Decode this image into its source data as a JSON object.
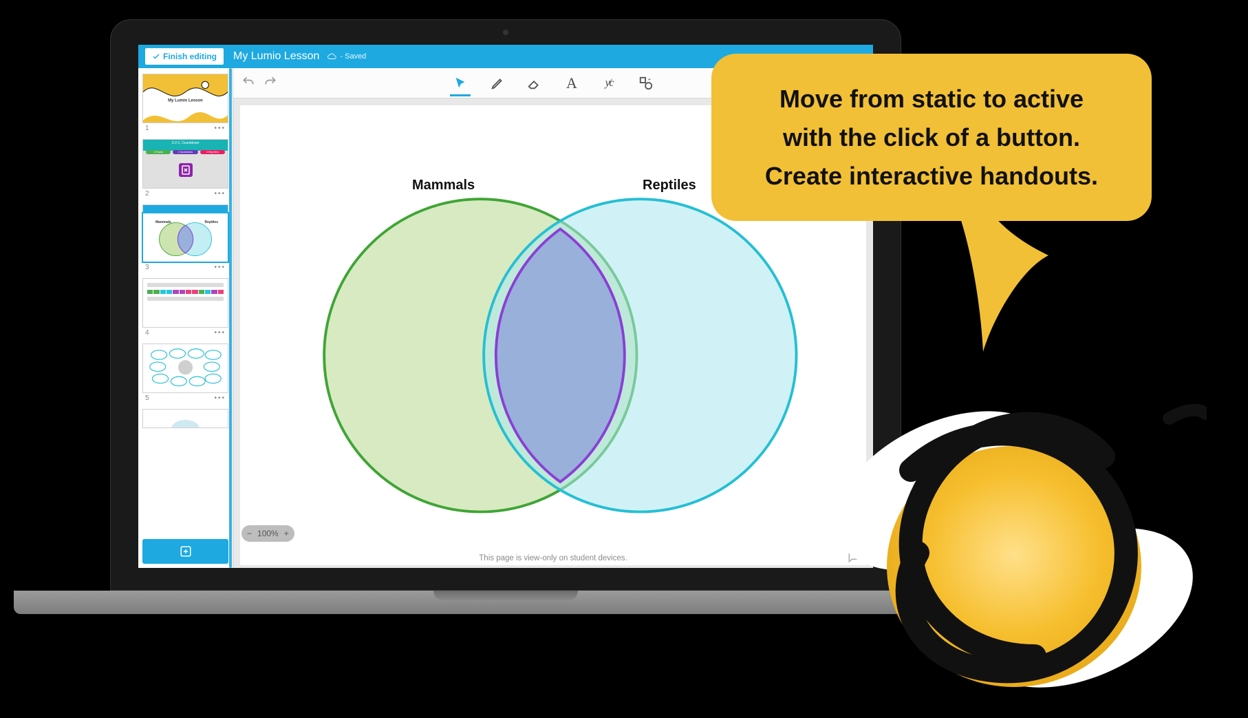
{
  "topbar": {
    "finish_label": "Finish editing",
    "title": "My Lumio Lesson",
    "saved_label": "- Saved"
  },
  "thumbs": [
    {
      "n": "1",
      "title": "My Lumio Lesson"
    },
    {
      "n": "2",
      "title": "3-2-1, Countdown",
      "pills": [
        "3 Facts",
        "2 Questions",
        "1 Big Idea"
      ]
    },
    {
      "n": "3",
      "left": "Mammals",
      "right": "Reptiles"
    },
    {
      "n": "4"
    },
    {
      "n": "5"
    }
  ],
  "canvas": {
    "left_label": "Mammals",
    "right_label": "Reptiles"
  },
  "zoom": {
    "value": "100%"
  },
  "footer": {
    "note": "This page is view-only on student devices."
  },
  "bubble": {
    "line1": "Move from static to active",
    "line2": "with the click of a button.",
    "line3": "Create interactive handouts."
  },
  "colors": {
    "brand": "#1ea9e1",
    "bubble": "#f2c036",
    "venn_left_stroke": "#3fa535",
    "venn_left_fill": "#b8d98f",
    "venn_right_stroke": "#25bfd4",
    "venn_right_fill": "#a9e7ef",
    "venn_mid_stroke": "#8a3fd4",
    "venn_mid_fill": "#93a6da"
  }
}
